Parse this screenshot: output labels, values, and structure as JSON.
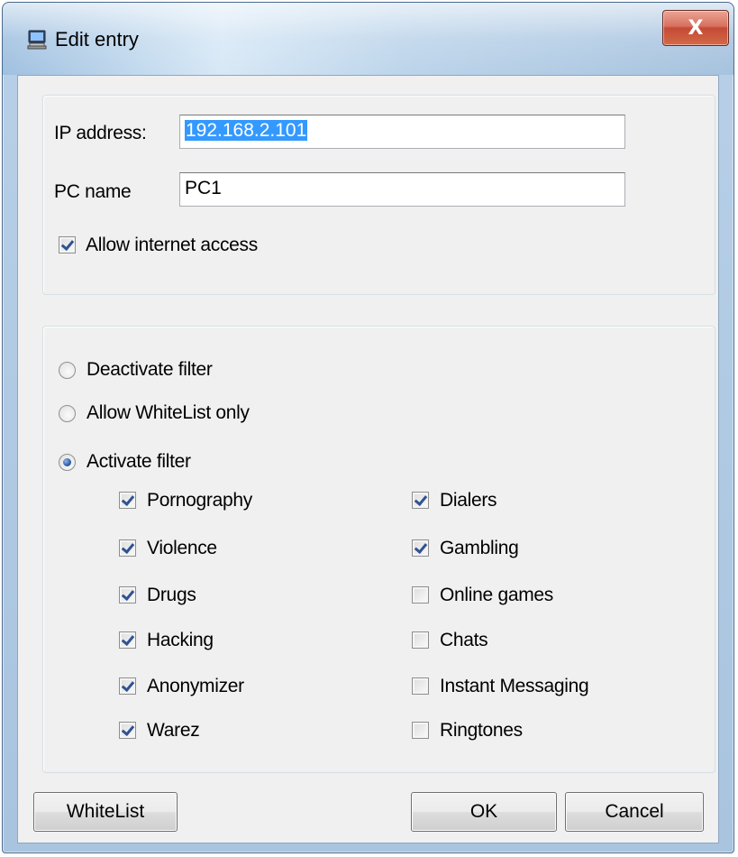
{
  "window": {
    "title": "Edit entry",
    "close_glyph": "X",
    "icon": "computer-icon"
  },
  "network": {
    "ip_label": "IP address:",
    "ip_value": "192.168.2.101",
    "pc_label": "PC name",
    "pc_value": "PC1",
    "allow_internet_label": "Allow internet access",
    "allow_internet_checked": true
  },
  "filter": {
    "options": [
      {
        "label": "Deactivate filter",
        "selected": false
      },
      {
        "label": "Allow WhiteList only",
        "selected": false
      },
      {
        "label": "Activate filter",
        "selected": true
      }
    ],
    "categories_left": [
      {
        "label": "Pornography",
        "checked": true
      },
      {
        "label": "Violence",
        "checked": true
      },
      {
        "label": "Drugs",
        "checked": true
      },
      {
        "label": "Hacking",
        "checked": true
      },
      {
        "label": "Anonymizer",
        "checked": true
      },
      {
        "label": "Warez",
        "checked": true
      }
    ],
    "categories_right": [
      {
        "label": "Dialers",
        "checked": true
      },
      {
        "label": "Gambling",
        "checked": true
      },
      {
        "label": "Online games",
        "checked": false
      },
      {
        "label": "Chats",
        "checked": false
      },
      {
        "label": "Instant Messaging",
        "checked": false
      },
      {
        "label": "Ringtones",
        "checked": false
      }
    ]
  },
  "buttons": {
    "whitelist": "WhiteList",
    "ok": "OK",
    "cancel": "Cancel"
  },
  "colors": {
    "selection": "#3399ff",
    "close_button": "#c44a34",
    "check_mark": "#2f5293"
  }
}
